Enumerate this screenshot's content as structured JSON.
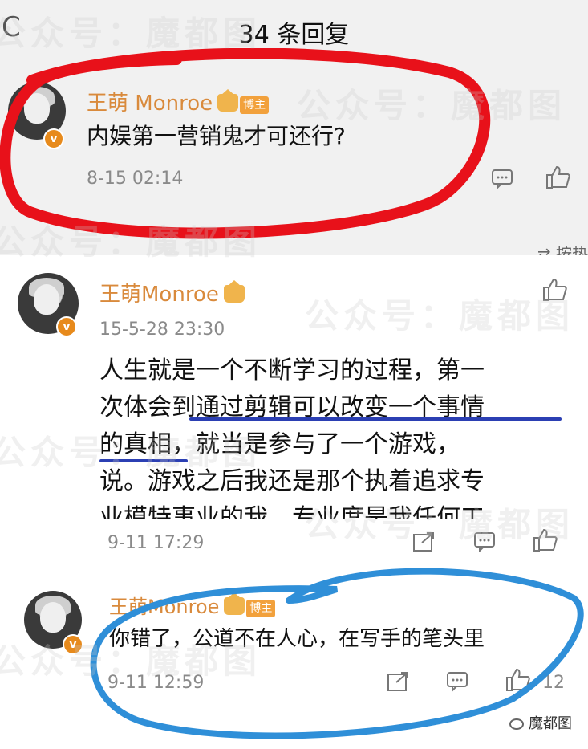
{
  "header": {
    "title": "34 条回复",
    "back_glyph": "C"
  },
  "comment_top": {
    "username": "王萌 Monroe",
    "badge": "博主",
    "text": "内娱第一营销鬼才可还行?",
    "time": "8-15 02:14"
  },
  "sort_label": "按热",
  "comment_main": {
    "username": "王萌Monroe",
    "time": "15-5-28 23:30",
    "lines": [
      "人生就是一个不断学习的过程，第一",
      "次体会到通过剪辑可以改变一个事情",
      "的真相，就当是参与了一个游戏，",
      "说。游戏之后我还是那个执着追求专",
      "业模特事业的我，专业度是我任何工"
    ]
  },
  "reply_1": {
    "time": "9-11 17:29"
  },
  "reply_2": {
    "username": "王萌Monroe",
    "badge": "博主",
    "text": "你错了，公道不在人心，在写手的笔头里",
    "time": "9-11 12:59",
    "like_count": "12"
  },
  "watermark": {
    "text": "公众号：魔都图"
  },
  "corner_mark": {
    "text": "魔都图"
  },
  "colors": {
    "username": "#d98a3c",
    "underline": "#2b3fb3",
    "red_mark": "#e8111a",
    "blue_mark": "#2f8fd8"
  }
}
